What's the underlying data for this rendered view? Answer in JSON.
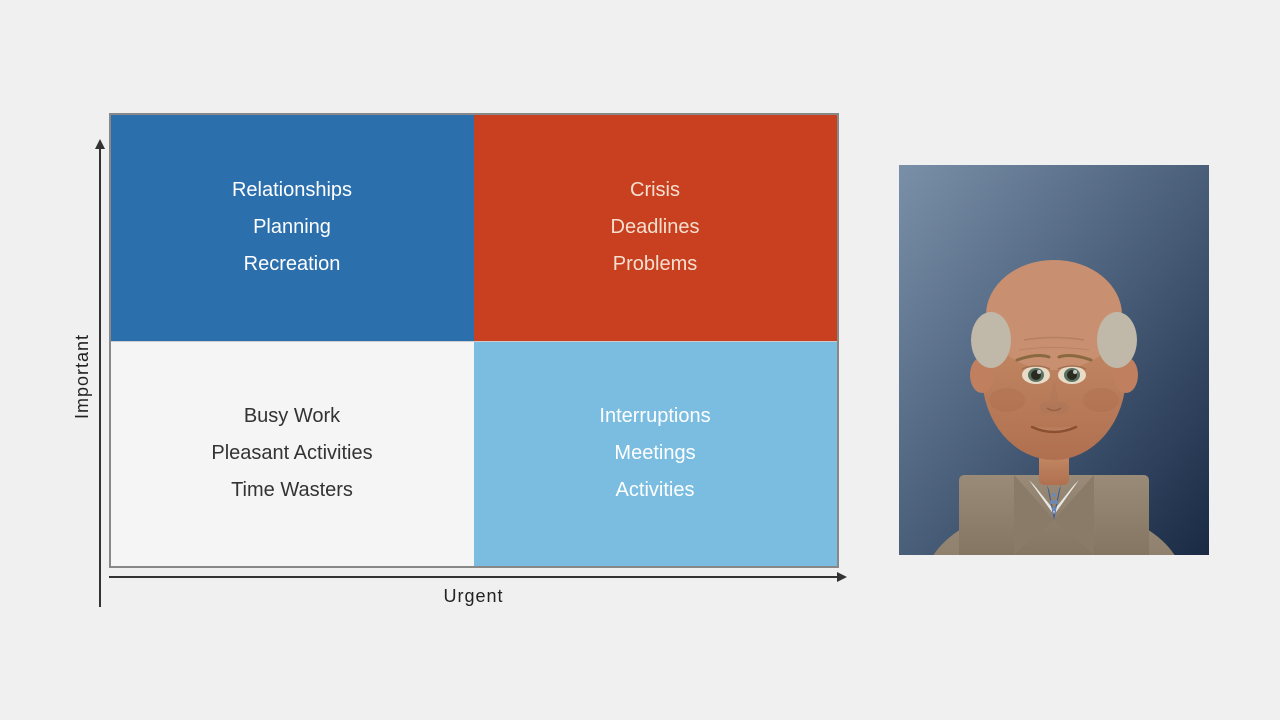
{
  "axes": {
    "x_label": "Urgent",
    "y_label": "Important"
  },
  "quadrants": {
    "q1": {
      "label": "not-urgent-important",
      "items": [
        "Relationships",
        "Planning",
        "Recreation"
      ]
    },
    "q2": {
      "label": "urgent-important",
      "items": [
        "Crisis",
        "Deadlines",
        "Problems"
      ]
    },
    "q3": {
      "label": "not-urgent-not-important",
      "items": [
        "Busy Work",
        "Pleasant Activities",
        "Time Wasters"
      ]
    },
    "q4": {
      "label": "urgent-not-important",
      "items": [
        "Interruptions",
        "Meetings",
        "Activities"
      ]
    }
  },
  "portrait": {
    "alt": "Eisenhower portrait"
  }
}
